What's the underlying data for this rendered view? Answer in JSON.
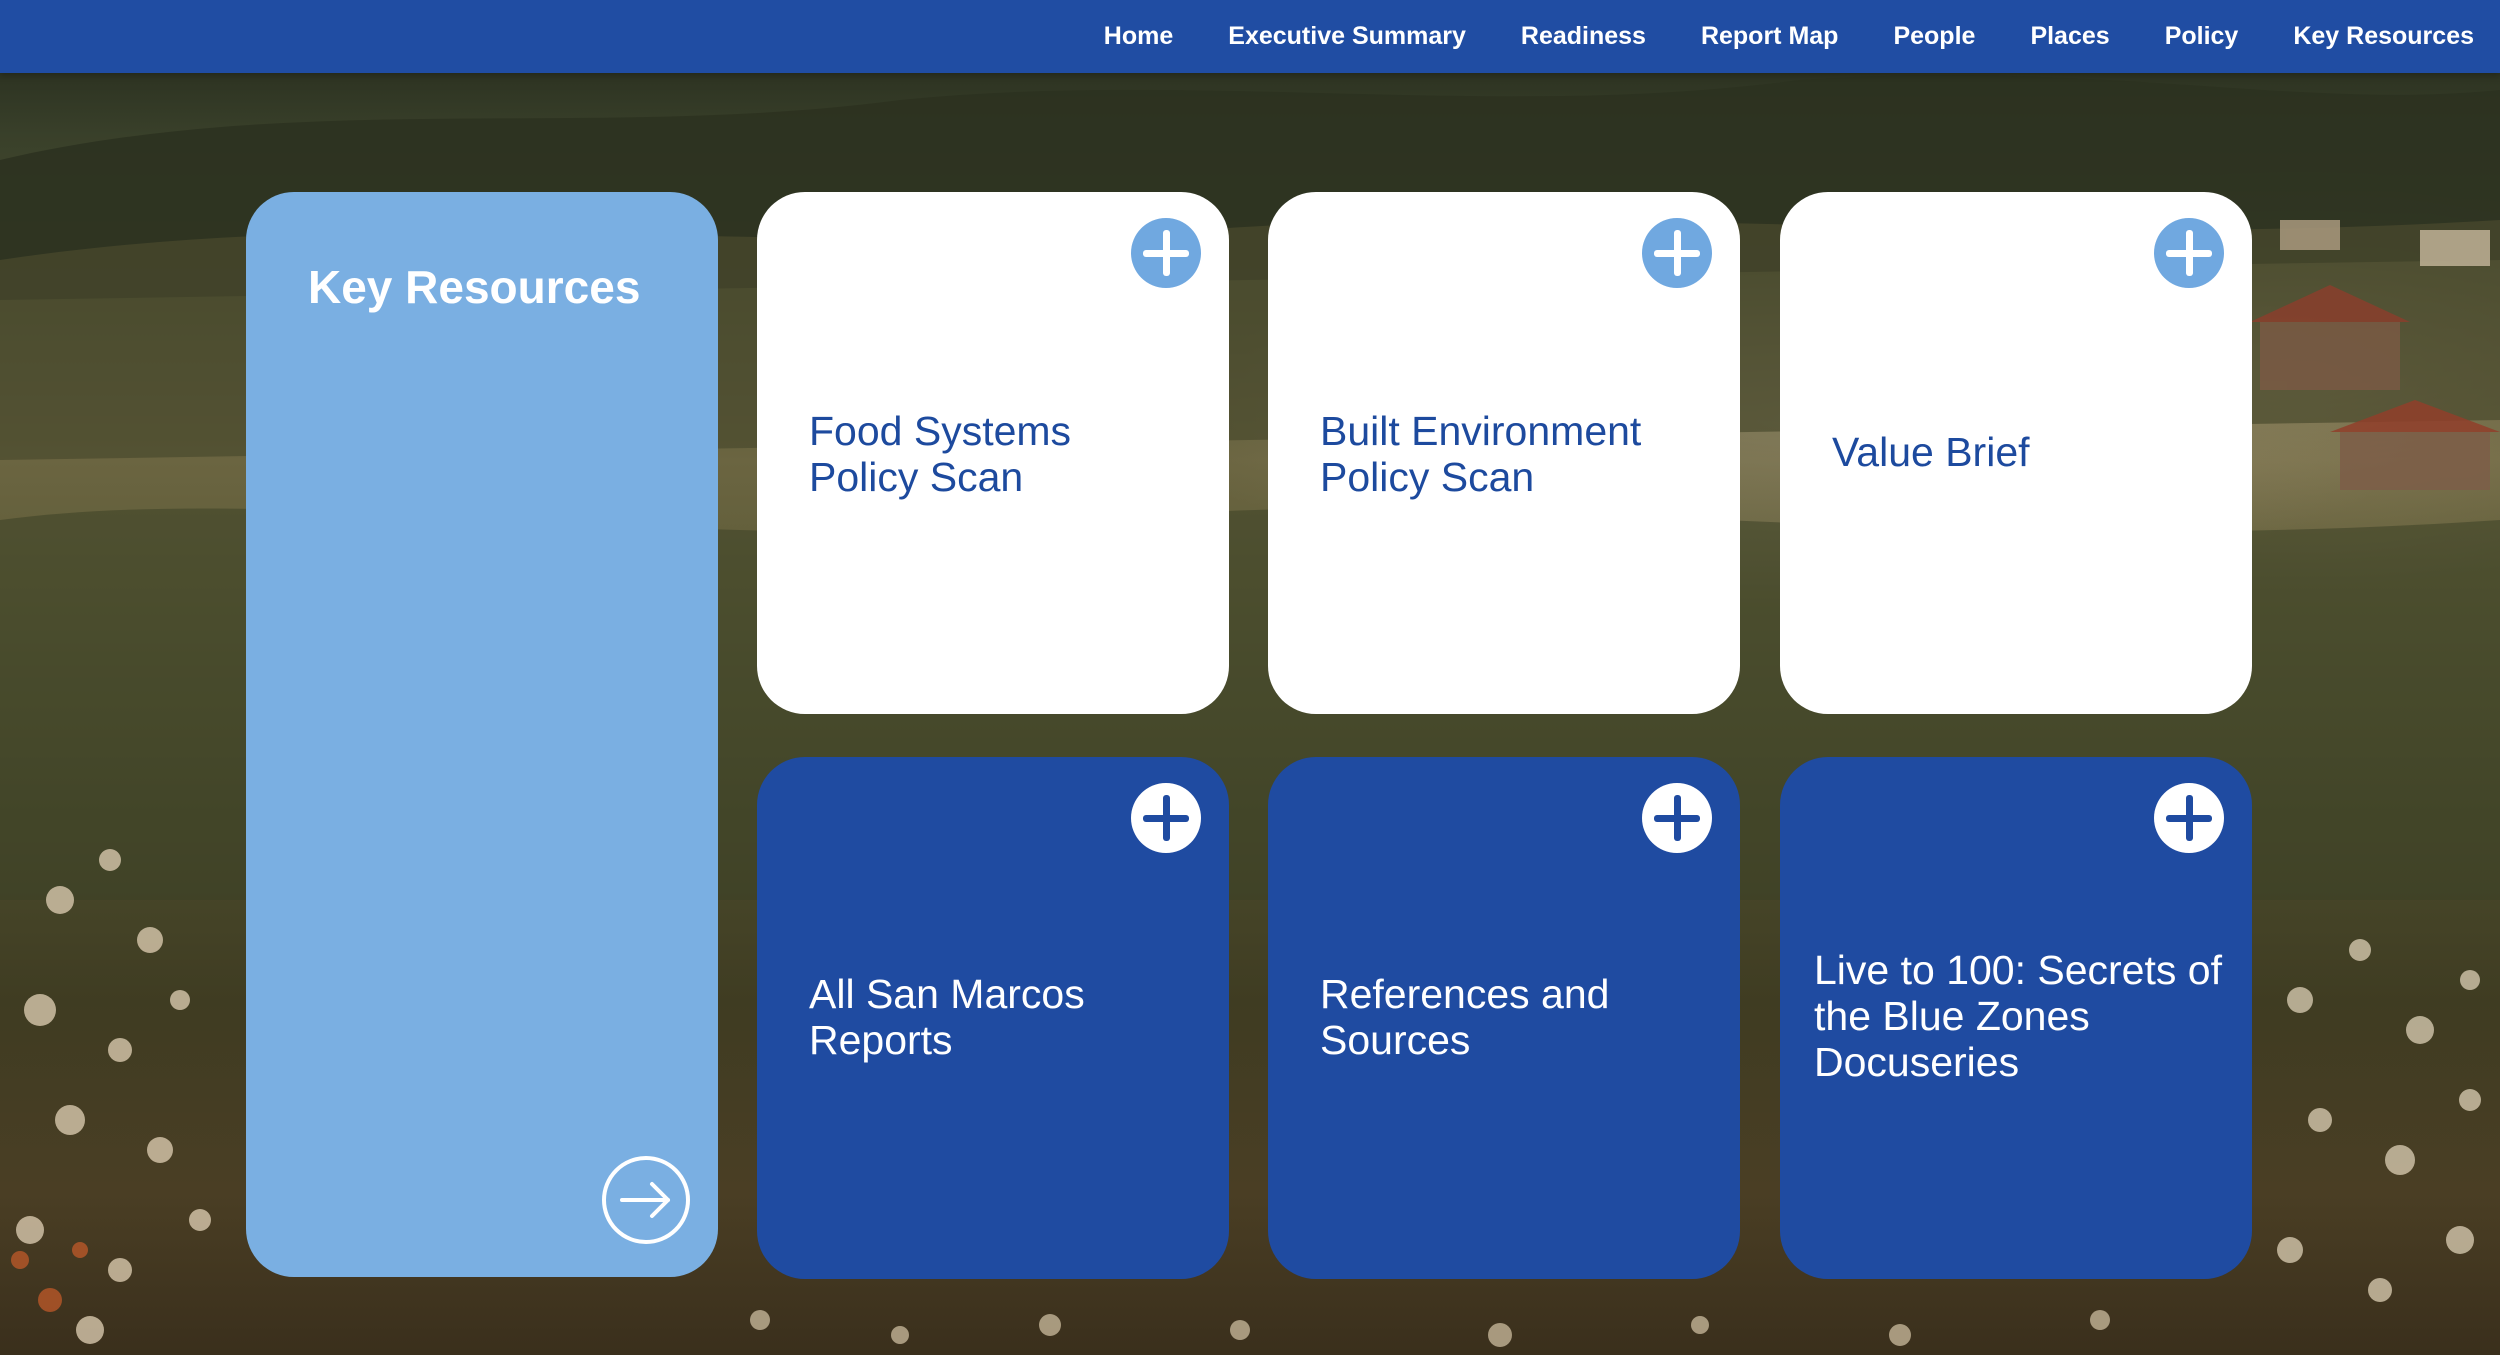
{
  "nav": {
    "items": [
      {
        "label": "Home"
      },
      {
        "label": "Executive Summary"
      },
      {
        "label": "Readiness"
      },
      {
        "label": "Report Map"
      },
      {
        "label": "People"
      },
      {
        "label": "Places"
      },
      {
        "label": "Policy"
      },
      {
        "label": "Key Resources"
      }
    ]
  },
  "intro": {
    "title": "Key Resources",
    "action_icon": "arrow-right-circle-icon"
  },
  "cards": [
    {
      "label": "Food Systems Policy Scan",
      "style": "white",
      "icon": "plus-circle-icon"
    },
    {
      "label": "Built Environment Policy Scan",
      "style": "white",
      "icon": "plus-circle-icon"
    },
    {
      "label": "Value Brief",
      "style": "white",
      "icon": "plus-circle-icon"
    },
    {
      "label": "All San Marcos Reports",
      "style": "blue",
      "icon": "plus-circle-icon"
    },
    {
      "label": "References and Sources",
      "style": "blue",
      "icon": "plus-circle-icon"
    },
    {
      "label": "Live to 100: Secrets of the Blue Zones Docuseries",
      "style": "blue",
      "icon": "plus-circle-icon"
    }
  ],
  "colors": {
    "nav_bg": "#204da3",
    "light_blue": "#7aafe2",
    "dark_blue": "#1f4ba1",
    "white": "#ffffff"
  }
}
